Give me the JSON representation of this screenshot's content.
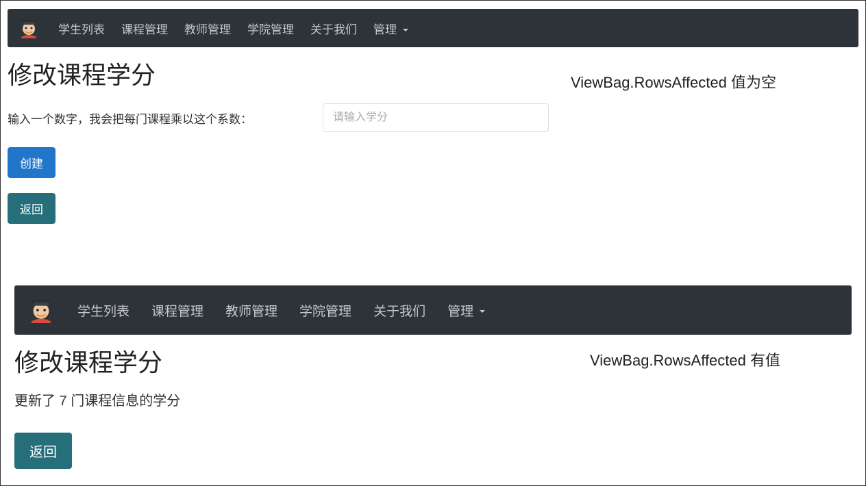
{
  "navbar": {
    "items": [
      {
        "label": "学生列表"
      },
      {
        "label": "课程管理"
      },
      {
        "label": "教师管理"
      },
      {
        "label": "学院管理"
      },
      {
        "label": "关于我们"
      },
      {
        "label": "管理"
      }
    ]
  },
  "section1": {
    "title": "修改课程学分",
    "formLabel": "输入一个数字，我会把每门课程乘以这个系数：",
    "inputPlaceholder": "请输入学分",
    "createBtn": "创建",
    "backBtn": "返回",
    "annotation": "ViewBag.RowsAffected 值为空"
  },
  "section2": {
    "title": "修改课程学分",
    "resultText": "更新了 7 门课程信息的学分",
    "backBtn": "返回",
    "annotation": "ViewBag.RowsAffected 有值"
  }
}
